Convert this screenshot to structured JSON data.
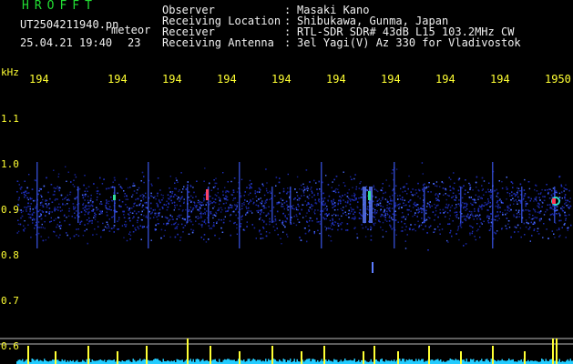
{
  "header": {
    "app_title": "HROFFT",
    "file_name": "UT2504211940.pn",
    "mode": "meteor",
    "date_time": "25.04.21 19:40",
    "seconds": "23",
    "observer_label": "Observer",
    "observer_value": "Masaki Kano",
    "location_label": "Receiving Location",
    "location_value": "Shibukawa, Gunma, Japan",
    "receiver_label": "Receiver",
    "receiver_value": "RTL-SDR SDR# 43dB L15 103.2MHz CW",
    "antenna_label": "Receiving Antenna",
    "antenna_value": "3el Yagi(V) Az 330 for Vladivostok",
    "separator": ":"
  },
  "chart_data": {
    "type": "heatmap",
    "ylabel": "kHz",
    "y_ticks": [
      "1.1",
      "1.0",
      "0.9",
      "0.8",
      "0.7",
      "0.6"
    ],
    "y_range": [
      0.6,
      1.15
    ],
    "x_ticks": [
      "194",
      "194",
      "194",
      "194",
      "194",
      "194",
      "194",
      "194",
      "194",
      "1950"
    ],
    "grid": false
  },
  "colors": {
    "header_green": "#22dd33",
    "text_white": "#f0f0f0",
    "axis_yellow": "#ffff33",
    "noise_blue": "#2233cc",
    "level_cyan": "#22ccff"
  }
}
